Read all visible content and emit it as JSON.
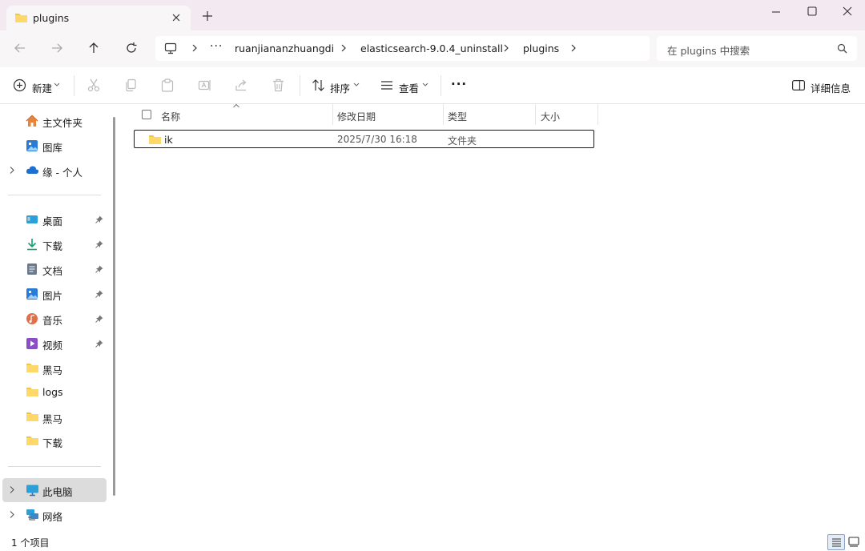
{
  "window": {
    "tab_title": "plugins",
    "new_tab_glyph": "+",
    "controls": [
      "minimize-icon",
      "maximize-icon",
      "close-icon"
    ]
  },
  "address": {
    "ellipsis": "···",
    "breadcrumbs": [
      "ruanjiananzhuangdi",
      "elasticsearch-9.0.4_uninstall",
      "plugins"
    ],
    "search_placeholder": "在 plugins 中搜索"
  },
  "toolbar": {
    "new_label": "新建",
    "sort_label": "排序",
    "view_label": "查看",
    "more_glyph": "···",
    "details_label": "详细信息",
    "icons": [
      "cut-icon",
      "copy-icon",
      "paste-icon",
      "rename-icon",
      "share-icon",
      "delete-icon"
    ]
  },
  "sidebar": {
    "top_items": [
      {
        "label": "主文件夹",
        "icon": "home-icon"
      },
      {
        "label": "图库",
        "icon": "gallery-icon"
      },
      {
        "label": "缘 - 个人",
        "icon": "onedrive-icon"
      }
    ],
    "quick_access": [
      {
        "label": "桌面",
        "icon": "desktop-icon",
        "pinned": true
      },
      {
        "label": "下载",
        "icon": "download-icon",
        "pinned": true
      },
      {
        "label": "文档",
        "icon": "document-icon",
        "pinned": true
      },
      {
        "label": "图片",
        "icon": "pictures-icon",
        "pinned": true
      },
      {
        "label": "音乐",
        "icon": "music-icon",
        "pinned": true
      },
      {
        "label": "视频",
        "icon": "video-icon",
        "pinned": true
      },
      {
        "label": "黑马",
        "icon": "folder-icon",
        "pinned": false
      },
      {
        "label": "logs",
        "icon": "folder-icon",
        "pinned": false
      },
      {
        "label": "黑马",
        "icon": "folder-icon",
        "pinned": false
      },
      {
        "label": "下载",
        "icon": "folder-icon",
        "pinned": false
      }
    ],
    "bottom_items": [
      {
        "label": "此电脑",
        "icon": "this-pc-icon",
        "selected": true
      },
      {
        "label": "网络",
        "icon": "network-icon",
        "selected": false
      }
    ]
  },
  "file_list": {
    "columns": [
      "名称",
      "修改日期",
      "类型",
      "大小"
    ],
    "rows": [
      {
        "name": "ik",
        "modified": "2025/7/30 16:18",
        "type": "文件夹",
        "size": "",
        "icon": "folder-icon"
      }
    ]
  },
  "status": {
    "item_count": "1 个项目",
    "view_modes": [
      "details-view-icon",
      "tiles-view-icon"
    ]
  },
  "colors": {
    "titlebar_bg": "#f2eaf0",
    "folder_yellow": "#f5c542",
    "accent_blue": "#2a7bd5",
    "selected_nav_bg": "#dcdcdc"
  }
}
